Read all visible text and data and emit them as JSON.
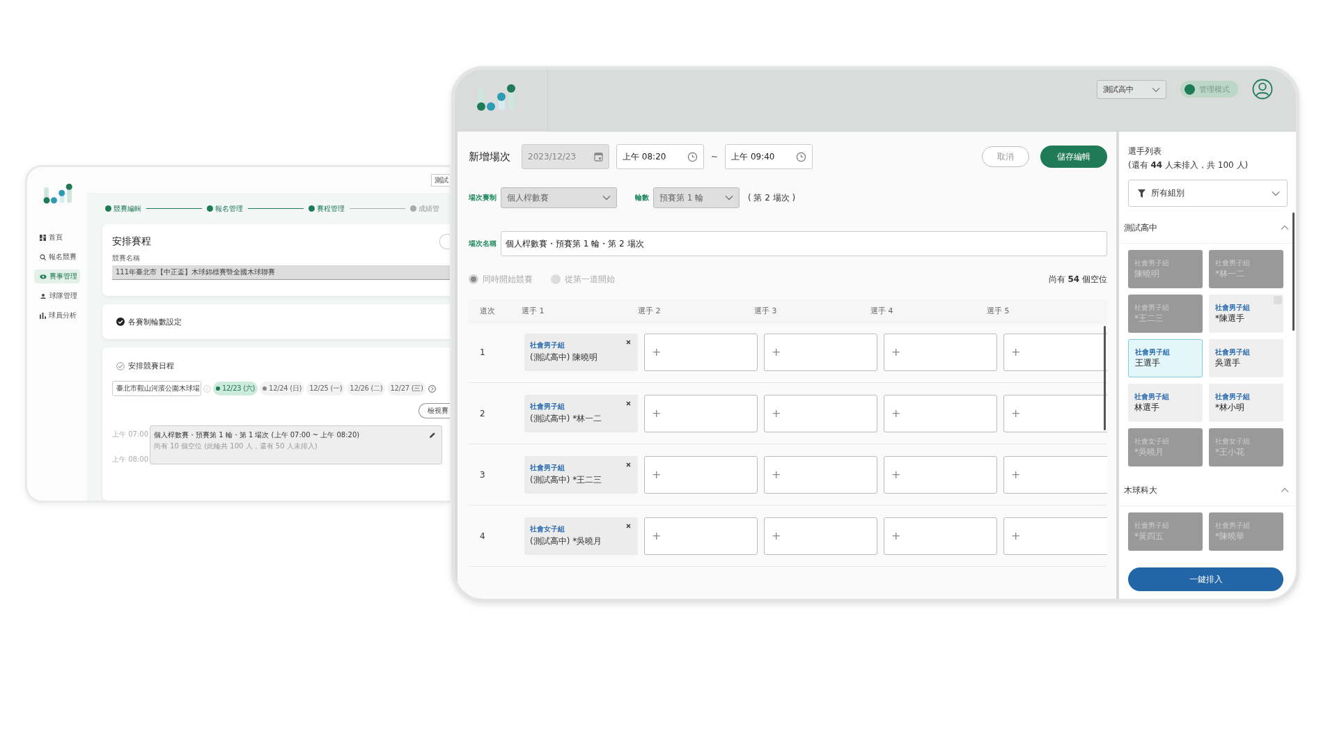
{
  "back_window": {
    "nav": [
      {
        "label": "首頁",
        "selected": false
      },
      {
        "label": "報名競賽",
        "selected": false
      },
      {
        "label": "賽事管理",
        "selected": true
      },
      {
        "label": "球隊管理",
        "selected": false
      },
      {
        "label": "球員分析",
        "selected": false
      }
    ],
    "top_chip": "測試",
    "steps": [
      {
        "label": "競賽編輯",
        "done": true
      },
      {
        "label": "報名管理",
        "done": true
      },
      {
        "label": "賽程管理",
        "done": true
      },
      {
        "label": "成績管",
        "done": false
      }
    ],
    "schedule_card": {
      "title": "安排賽程",
      "field_label": "競賽名稱",
      "field_value": "111年臺北市【中正盃】木球錦標賽暨全國木球聯賽"
    },
    "rounds_card": {
      "title": "各賽制輪數設定",
      "checked": true
    },
    "dates_card": {
      "title": "安排競賽日程",
      "checked": false,
      "venue": "臺北市觀山河濱公園木球場",
      "dates": [
        {
          "label": "12/23 (六)",
          "selected": true,
          "has_events": true
        },
        {
          "label": "12/24 (日)",
          "selected": false,
          "has_events": true
        },
        {
          "label": "12/25 (一)",
          "selected": false,
          "has_events": false
        },
        {
          "label": "12/26 (二)",
          "selected": false,
          "has_events": false
        },
        {
          "label": "12/27 (三)",
          "selected": false,
          "has_events": false
        }
      ],
      "view_button": "檢視賽",
      "times": [
        "上午 07:00",
        "上午 08:00"
      ],
      "session": {
        "title": "個人桿數賽・預賽第 1 輪・第 1 場次 (上午 07:00 ~ 上午 08:20)",
        "detail": "尚有 10 個空位 (此輪共 100 人，還有 50 人未排入)"
      }
    }
  },
  "front_window": {
    "header": {
      "school": "測試高中",
      "mode": {
        "label": "管理模式",
        "on": true
      }
    },
    "form": {
      "title": "新增場次",
      "date": "2023/12/23",
      "start_time": "上午 08:20",
      "separator": "~",
      "end_time": "上午 09:40",
      "cancel_button": "取消",
      "save_button": "儲存編輯",
      "format_label": "場次賽制",
      "format_value": "個人桿數賽",
      "round_label": "輪數",
      "round_value": "預賽第 1 輪",
      "session_note": "( 第 2 場次 )",
      "name_label": "場次名稱",
      "name_value": "個人桿數賽・預賽第 1 輪・第 2 場次",
      "start_options": [
        {
          "label": "同時開始競賽",
          "selected": true,
          "disabled": true
        },
        {
          "label": "從第一道開始",
          "selected": false,
          "disabled": true
        }
      ],
      "vacancy": "尚有 **54** 個空位"
    },
    "table": {
      "columns": [
        "道次",
        "選手 1",
        "選手 2",
        "選手 3",
        "選手 4",
        "選手 5"
      ],
      "rows": [
        {
          "lane": "1",
          "player": {
            "group": "社會男子組",
            "name": "(測試高中) 陳曉明"
          },
          "add": [
            "+",
            "+",
            "+",
            "+"
          ]
        },
        {
          "lane": "2",
          "player": {
            "group": "社會男子組",
            "name": "(測試高中) *林一二"
          },
          "add": [
            "+",
            "+",
            "+",
            "+"
          ]
        },
        {
          "lane": "3",
          "player": {
            "group": "社會男子組",
            "name": "(測試高中) *王二三"
          },
          "add": [
            "+",
            "+",
            "+",
            "+"
          ]
        },
        {
          "lane": "4",
          "player": {
            "group": "社會女子組",
            "name": "(測試高中) *吳曉月"
          },
          "add": [
            "+",
            "+",
            "+",
            "+"
          ]
        }
      ]
    },
    "sidebar": {
      "title": "選手列表",
      "summary": "(還有 **44** 人未排入，共 100 人)",
      "filter": "所有組別",
      "sections": [
        {
          "name": "測試高中",
          "expanded": true,
          "players": [
            {
              "group": "社會男子組",
              "name": "陳曉明",
              "placed": true,
              "selected": false,
              "flagged": false
            },
            {
              "group": "社會男子組",
              "name": "*林一二",
              "placed": true,
              "selected": false,
              "flagged": false
            },
            {
              "group": "社會男子組",
              "name": "*王二三",
              "placed": true,
              "selected": false,
              "flagged": false
            },
            {
              "group": "社會男子組",
              "name": "*陳選手",
              "placed": false,
              "selected": false,
              "flagged": true
            },
            {
              "group": "社會男子組",
              "name": "王選手",
              "placed": false,
              "selected": true,
              "flagged": false
            },
            {
              "group": "社會男子組",
              "name": "吳選手",
              "placed": false,
              "selected": false,
              "flagged": false
            },
            {
              "group": "社會男子組",
              "name": "林選手",
              "placed": false,
              "selected": false,
              "flagged": false
            },
            {
              "group": "社會男子組",
              "name": "*林小明",
              "placed": false,
              "selected": false,
              "flagged": false
            },
            {
              "group": "社會女子組",
              "name": "*吳曉月",
              "placed": true,
              "selected": false,
              "flagged": false
            },
            {
              "group": "社會女子組",
              "name": "*王小花",
              "placed": true,
              "selected": false,
              "flagged": false
            }
          ]
        },
        {
          "name": "木球科大",
          "expanded": true,
          "players": [
            {
              "group": "社會男子組",
              "name": "*黃四五",
              "placed": true,
              "selected": false,
              "flagged": false
            },
            {
              "group": "社會男子組",
              "name": "*陳曉華",
              "placed": true,
              "selected": false,
              "flagged": false
            }
          ]
        }
      ],
      "auto_button": "一鍵排入"
    }
  }
}
